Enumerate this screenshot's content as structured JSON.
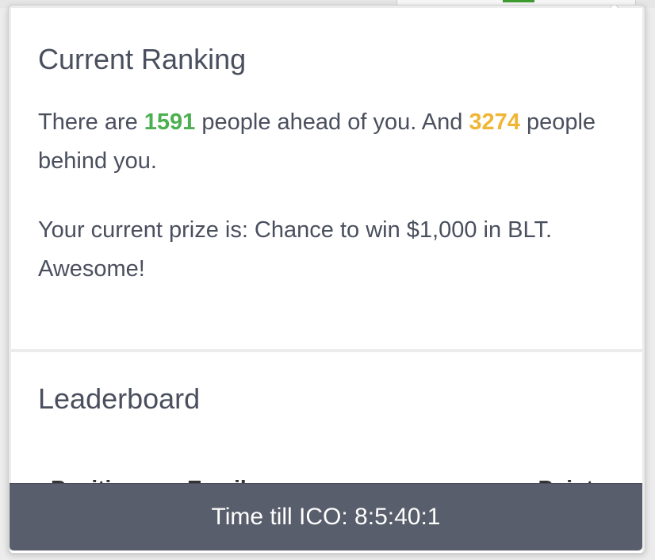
{
  "ranking": {
    "title": "Current Ranking",
    "text_before_ahead": "There are ",
    "ahead_count": "1591",
    "text_between": " people ahead of you. And ",
    "behind_count": "3274",
    "text_after_behind": " people behind you.",
    "prize_text": "Your current prize is: Chance to win $1,000 in BLT. Awesome!"
  },
  "leaderboard": {
    "title": "Leaderboard",
    "columns": [
      "Position",
      "Email",
      "Points"
    ]
  },
  "ico_timer": {
    "label": "Time till ICO: 8:5:40:1"
  },
  "colors": {
    "ahead": "#4caf50",
    "behind": "#f0b535",
    "bar": "#585e6c"
  }
}
